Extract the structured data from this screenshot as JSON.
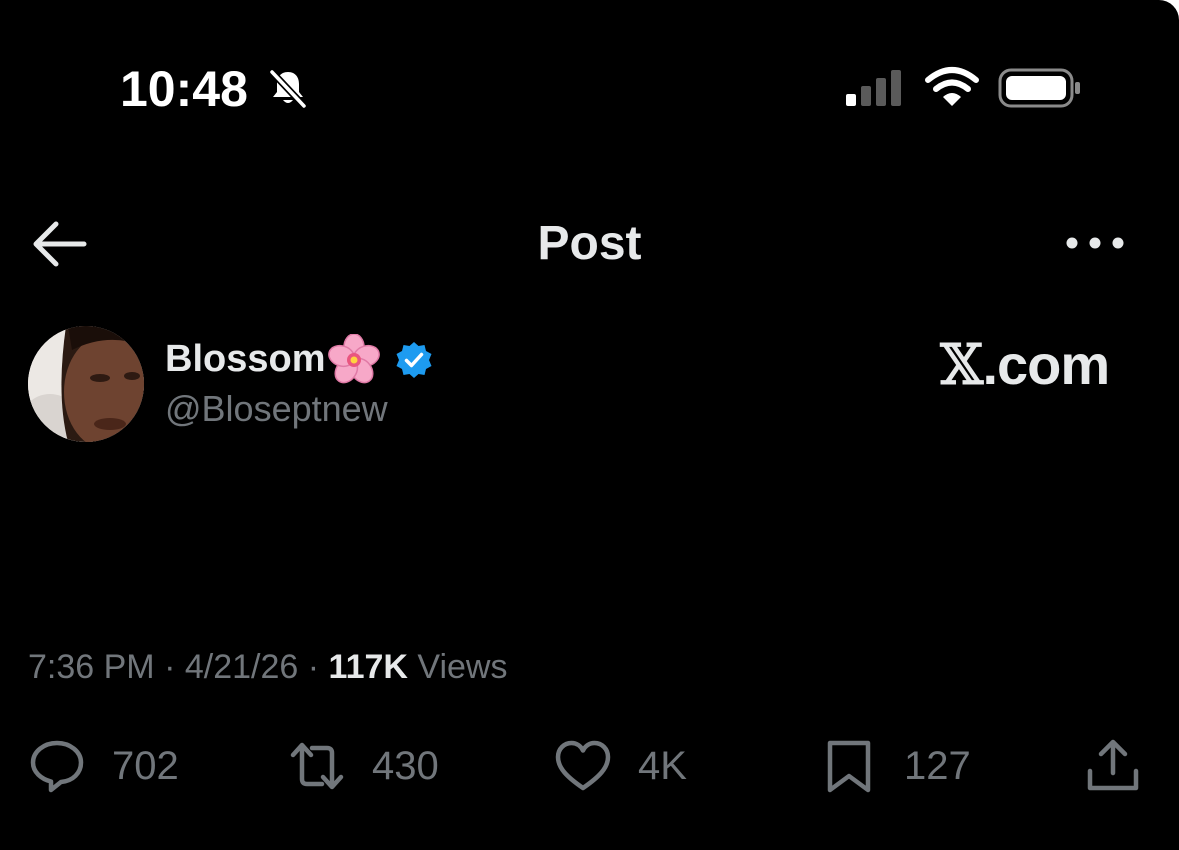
{
  "status_bar": {
    "time": "10:48",
    "icons": [
      "bell-slash-icon",
      "cellular-signal-icon",
      "wifi-icon",
      "battery-icon"
    ]
  },
  "header": {
    "title": "Post",
    "back_icon": "arrow-left-icon",
    "more_icon": "more-horizontal-icon"
  },
  "post": {
    "author": {
      "name": "Blossom",
      "emoji": "🌸",
      "verified": true,
      "handle": "@Bloseptnew"
    },
    "watermark": {
      "x": "𝕏",
      "suffix": ".com"
    },
    "meta": {
      "time": "7:36 PM",
      "date": "4/21/26",
      "sep": "·",
      "views_count": "117K",
      "views_label": "Views"
    },
    "actions": {
      "replies": "702",
      "reposts": "430",
      "likes": "4K",
      "bookmarks": "127"
    }
  },
  "colors": {
    "background": "#000000",
    "primary_text": "#e7e9ea",
    "secondary_text": "#71767b",
    "verified_blue": "#1d9bf0"
  }
}
